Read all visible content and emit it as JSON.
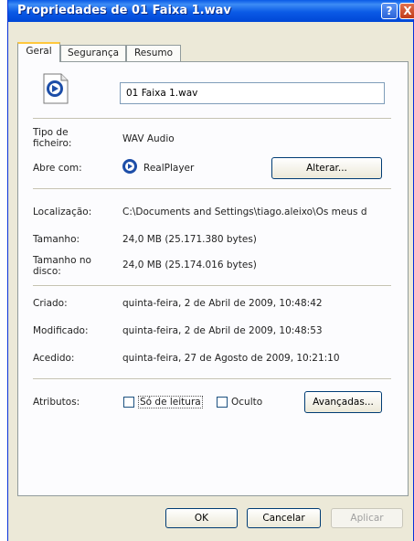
{
  "window": {
    "title": "Propriedades de 01 Faixa 1.wav",
    "help_icon": "?",
    "close_icon": "X"
  },
  "tabs": [
    {
      "label": "Geral"
    },
    {
      "label": "Segurança"
    },
    {
      "label": "Resumo"
    }
  ],
  "file": {
    "name": "01 Faixa 1.wav",
    "icon": "realplayer-file-icon"
  },
  "type": {
    "label": "Tipo de ficheiro:",
    "value": "WAV Audio"
  },
  "opens_with": {
    "label": "Abre com:",
    "app": "RealPlayer",
    "change_button": "Alterar..."
  },
  "location": {
    "label": "Localização:",
    "value": "C:\\Documents and Settings\\tiago.aleixo\\Os meus d"
  },
  "size": {
    "label": "Tamanho:",
    "value": "24,0 MB (25.171.380 bytes)"
  },
  "size_on_disk": {
    "label": "Tamanho no disco:",
    "value": "24,0 MB (25.174.016 bytes)"
  },
  "created": {
    "label": "Criado:",
    "value": "quinta-feira, 2 de Abril de 2009, 10:48:42"
  },
  "modified": {
    "label": "Modificado:",
    "value": "quinta-feira, 2 de Abril de 2009, 10:48:53"
  },
  "accessed": {
    "label": "Acedido:",
    "value": "quinta-feira, 27 de Agosto de 2009, 10:21:10"
  },
  "attributes": {
    "label": "Atributos:",
    "readonly": {
      "label": "Só de leitura",
      "checked": false
    },
    "hidden": {
      "label": "Oculto",
      "checked": false
    },
    "advanced_button": "Avançadas..."
  },
  "footer": {
    "ok": "OK",
    "cancel": "Cancelar",
    "apply": "Aplicar"
  },
  "colors": {
    "titlebar": "#0a5ae6",
    "dialog": "#ece9d8",
    "tab_highlight": "#ffc73c"
  }
}
